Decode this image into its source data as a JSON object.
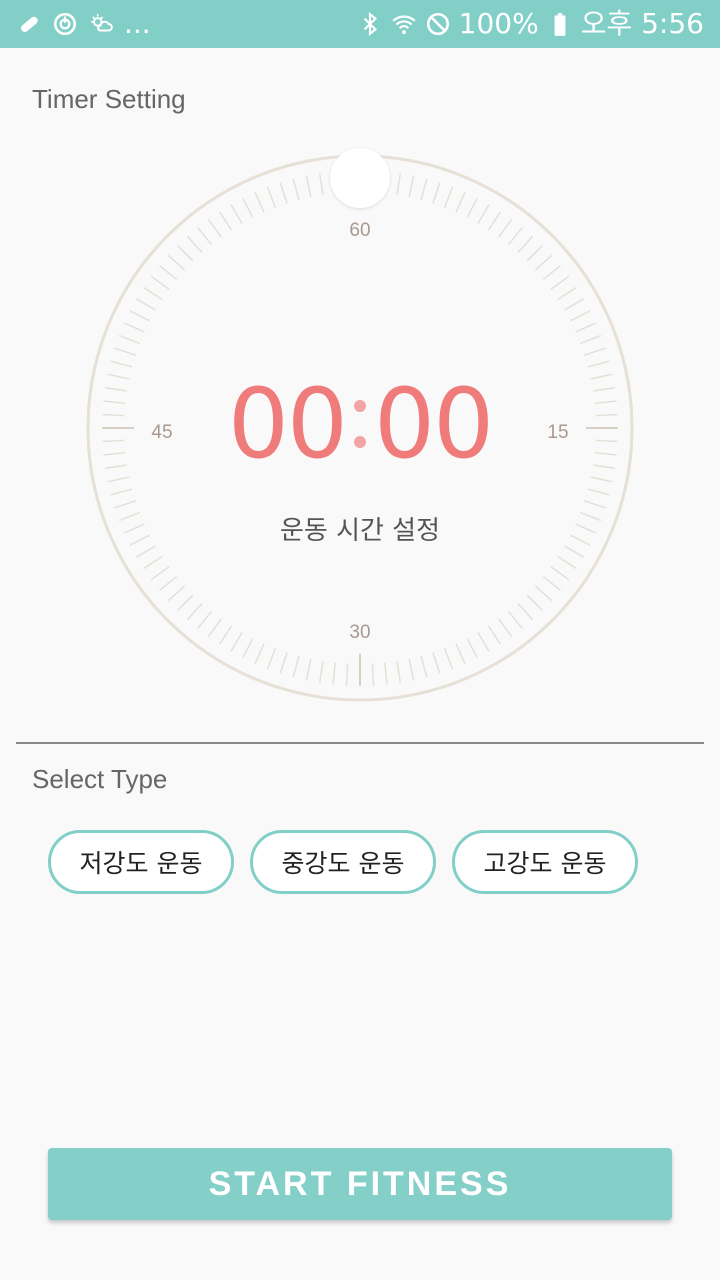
{
  "status_bar": {
    "left_icons": [
      "bandage-icon",
      "power-timer-icon",
      "weather-icon"
    ],
    "more": "...",
    "battery": "100%",
    "time": "오후 5:56",
    "background": "#82cfc8"
  },
  "timer_section": {
    "title": "Timer Setting",
    "dial_labels": {
      "top": "60",
      "right": "15",
      "bottom": "30",
      "left": "45"
    },
    "time_minutes": "00",
    "time_seconds": "00",
    "subtitle": "운동 시간 설정",
    "time_color": "#f07b7b"
  },
  "type_section": {
    "title": "Select Type",
    "options": [
      {
        "label": "저강도 운동"
      },
      {
        "label": "중강도 운동"
      },
      {
        "label": "고강도 운동"
      }
    ],
    "accent": "#82cfc8"
  },
  "start_button": {
    "label": "START FITNESS"
  }
}
